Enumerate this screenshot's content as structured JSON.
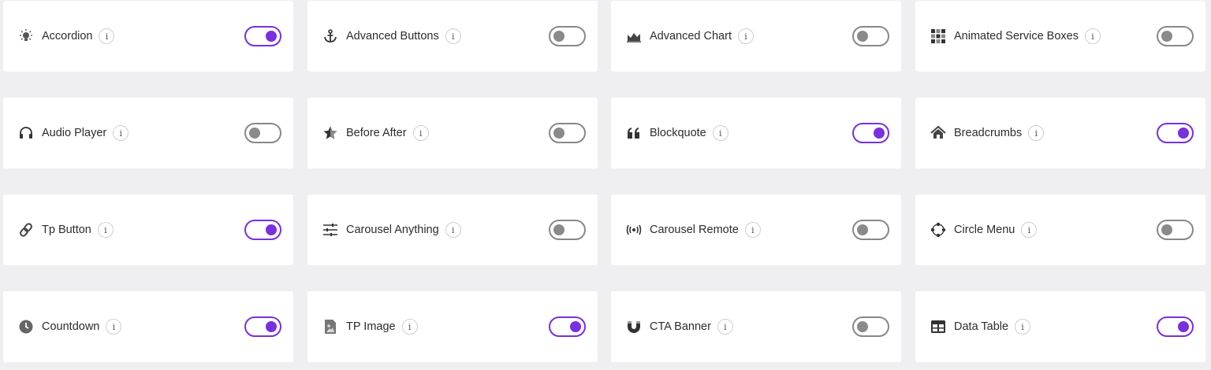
{
  "accent_color": "#7a2fe0",
  "off_color": "#8a8a8a",
  "info_glyph": "i",
  "widgets": [
    {
      "label": "Accordion",
      "icon": "lightbulb-icon",
      "enabled": true
    },
    {
      "label": "Advanced Buttons",
      "icon": "anchor-icon",
      "enabled": false
    },
    {
      "label": "Advanced Chart",
      "icon": "area-chart-icon",
      "enabled": false
    },
    {
      "label": "Animated Service Boxes",
      "icon": "grid-boxes-icon",
      "enabled": false
    },
    {
      "label": "Audio Player",
      "icon": "headphones-icon",
      "enabled": false
    },
    {
      "label": "Before After",
      "icon": "half-star-icon",
      "enabled": false
    },
    {
      "label": "Blockquote",
      "icon": "quote-icon",
      "enabled": true
    },
    {
      "label": "Breadcrumbs",
      "icon": "home-icon",
      "enabled": true
    },
    {
      "label": "Tp Button",
      "icon": "link-icon",
      "enabled": true
    },
    {
      "label": "Carousel Anything",
      "icon": "sliders-icon",
      "enabled": false
    },
    {
      "label": "Carousel Remote",
      "icon": "broadcast-icon",
      "enabled": false
    },
    {
      "label": "Circle Menu",
      "icon": "circle-menu-icon",
      "enabled": false
    },
    {
      "label": "Countdown",
      "icon": "clock-icon",
      "enabled": true
    },
    {
      "label": "TP Image",
      "icon": "image-icon",
      "enabled": true
    },
    {
      "label": "CTA Banner",
      "icon": "magnet-icon",
      "enabled": false
    },
    {
      "label": "Data Table",
      "icon": "table-icon",
      "enabled": true
    }
  ]
}
